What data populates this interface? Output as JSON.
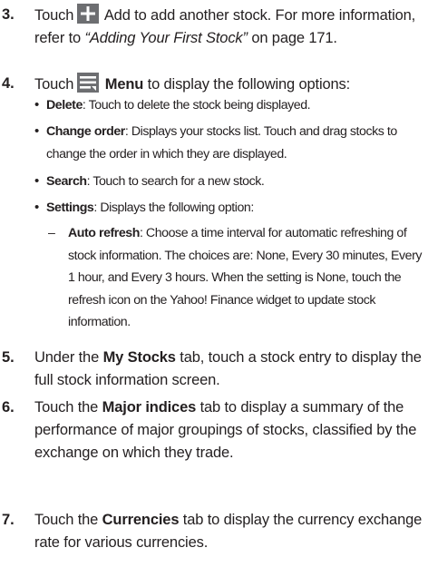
{
  "steps": [
    {
      "number": "3.",
      "part1": "Touch",
      "icon": "add-icon",
      "part2": "Add to add another stock. For more information, refer to",
      "link": "“Adding Your First Stock”",
      "part3": "on page 171."
    },
    {
      "number": "4.",
      "part1": "Touch",
      "icon": "menu-icon",
      "bold": "Menu",
      "part2": "to display the following options:",
      "bullets": [
        {
          "term": "Delete",
          "text": ": Touch to delete the stock being displayed."
        },
        {
          "term": "Change order",
          "text": ": Displays your stocks list. Touch and drag stocks to change the order in which they are displayed."
        },
        {
          "term": "Search",
          "text": ": Touch to search for a new stock."
        },
        {
          "term": "Settings",
          "text": ": Displays the following option:"
        }
      ],
      "sub": {
        "dash": "–",
        "term": "Auto refresh",
        "text": ": Choose a time interval for automatic refreshing of stock information. The choices are: None, Every 30 minutes, Every 1 hour, and Every 3 hours. When the setting is None, touch the refresh icon on the Yahoo! Finance widget to update stock information."
      }
    },
    {
      "number": "5.",
      "part1": "Under the",
      "bold": "My Stocks",
      "part2": "tab, touch a stock entry to display the full stock information screen."
    },
    {
      "number": "6.",
      "part1": "Touch the",
      "bold": "Major indices",
      "part2": "tab to display a summary of the performance of major groupings of stocks, classified by the exchange on which they trade."
    },
    {
      "number": "7.",
      "part1": "Touch the",
      "bold": "Currencies",
      "part2": "tab to display the currency exchange rate for various currencies."
    }
  ],
  "bullet_char": "•",
  "colors": {
    "text": "#231f20",
    "icon_bg": "#6d6e71",
    "icon_fg": "#ffffff"
  }
}
